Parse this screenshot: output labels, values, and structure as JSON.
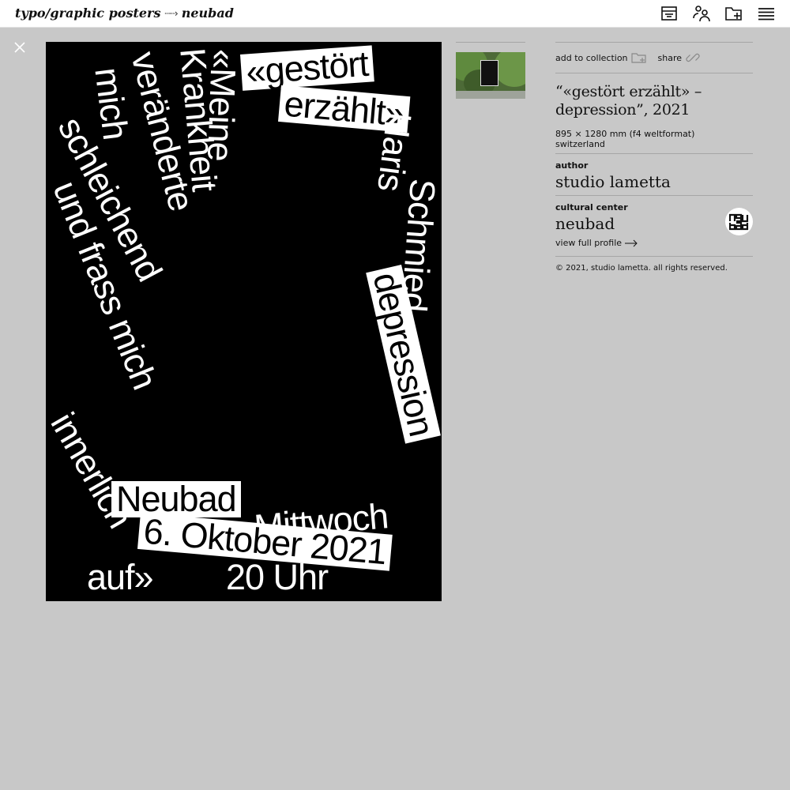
{
  "header": {
    "breadcrumb_root": "typo/graphic posters",
    "breadcrumb_sep": "┈┈›",
    "breadcrumb_current": "neubad",
    "icons": [
      "archive-icon",
      "people-icon",
      "add-folder-icon",
      "menu-icon"
    ]
  },
  "poster_text": {
    "l1": "«gestört",
    "l2": "erzählt»",
    "l3": "«Meine",
    "l4": "Krankheit",
    "l5": "veränderte",
    "l6": "mich",
    "l7": "schleichend",
    "l8": "und frass mich",
    "l9": "innerlich",
    "l10": "auf»",
    "l11": "Haris",
    "l12": "Schmied",
    "l13": "depression",
    "l14": "Neubad",
    "l15": "Mittwoch",
    "l16": "6. Oktober 2021",
    "l17": "20 Uhr"
  },
  "actions": {
    "add_to_collection": "add to collection",
    "share": "share"
  },
  "poster": {
    "title_line1": "“«gestört erzählt» –",
    "title_line2": "depression”, 2021",
    "size": "895 × 1280 mm (f4 weltformat)",
    "country": "switzerland"
  },
  "author": {
    "label": "author",
    "name": "studio lametta"
  },
  "cultural_center": {
    "label": "cultural center",
    "name": "neubad",
    "logo_text": "neu bad",
    "profile_link": "view full profile"
  },
  "copyright": "© 2021, studio lametta. all rights reserved.",
  "colors": {
    "page_bg": "#c8c8c8",
    "header_bg": "#ffffff",
    "poster_bg": "#000000",
    "poster_text": "#ffffff",
    "divider": "#a6a6a6"
  }
}
